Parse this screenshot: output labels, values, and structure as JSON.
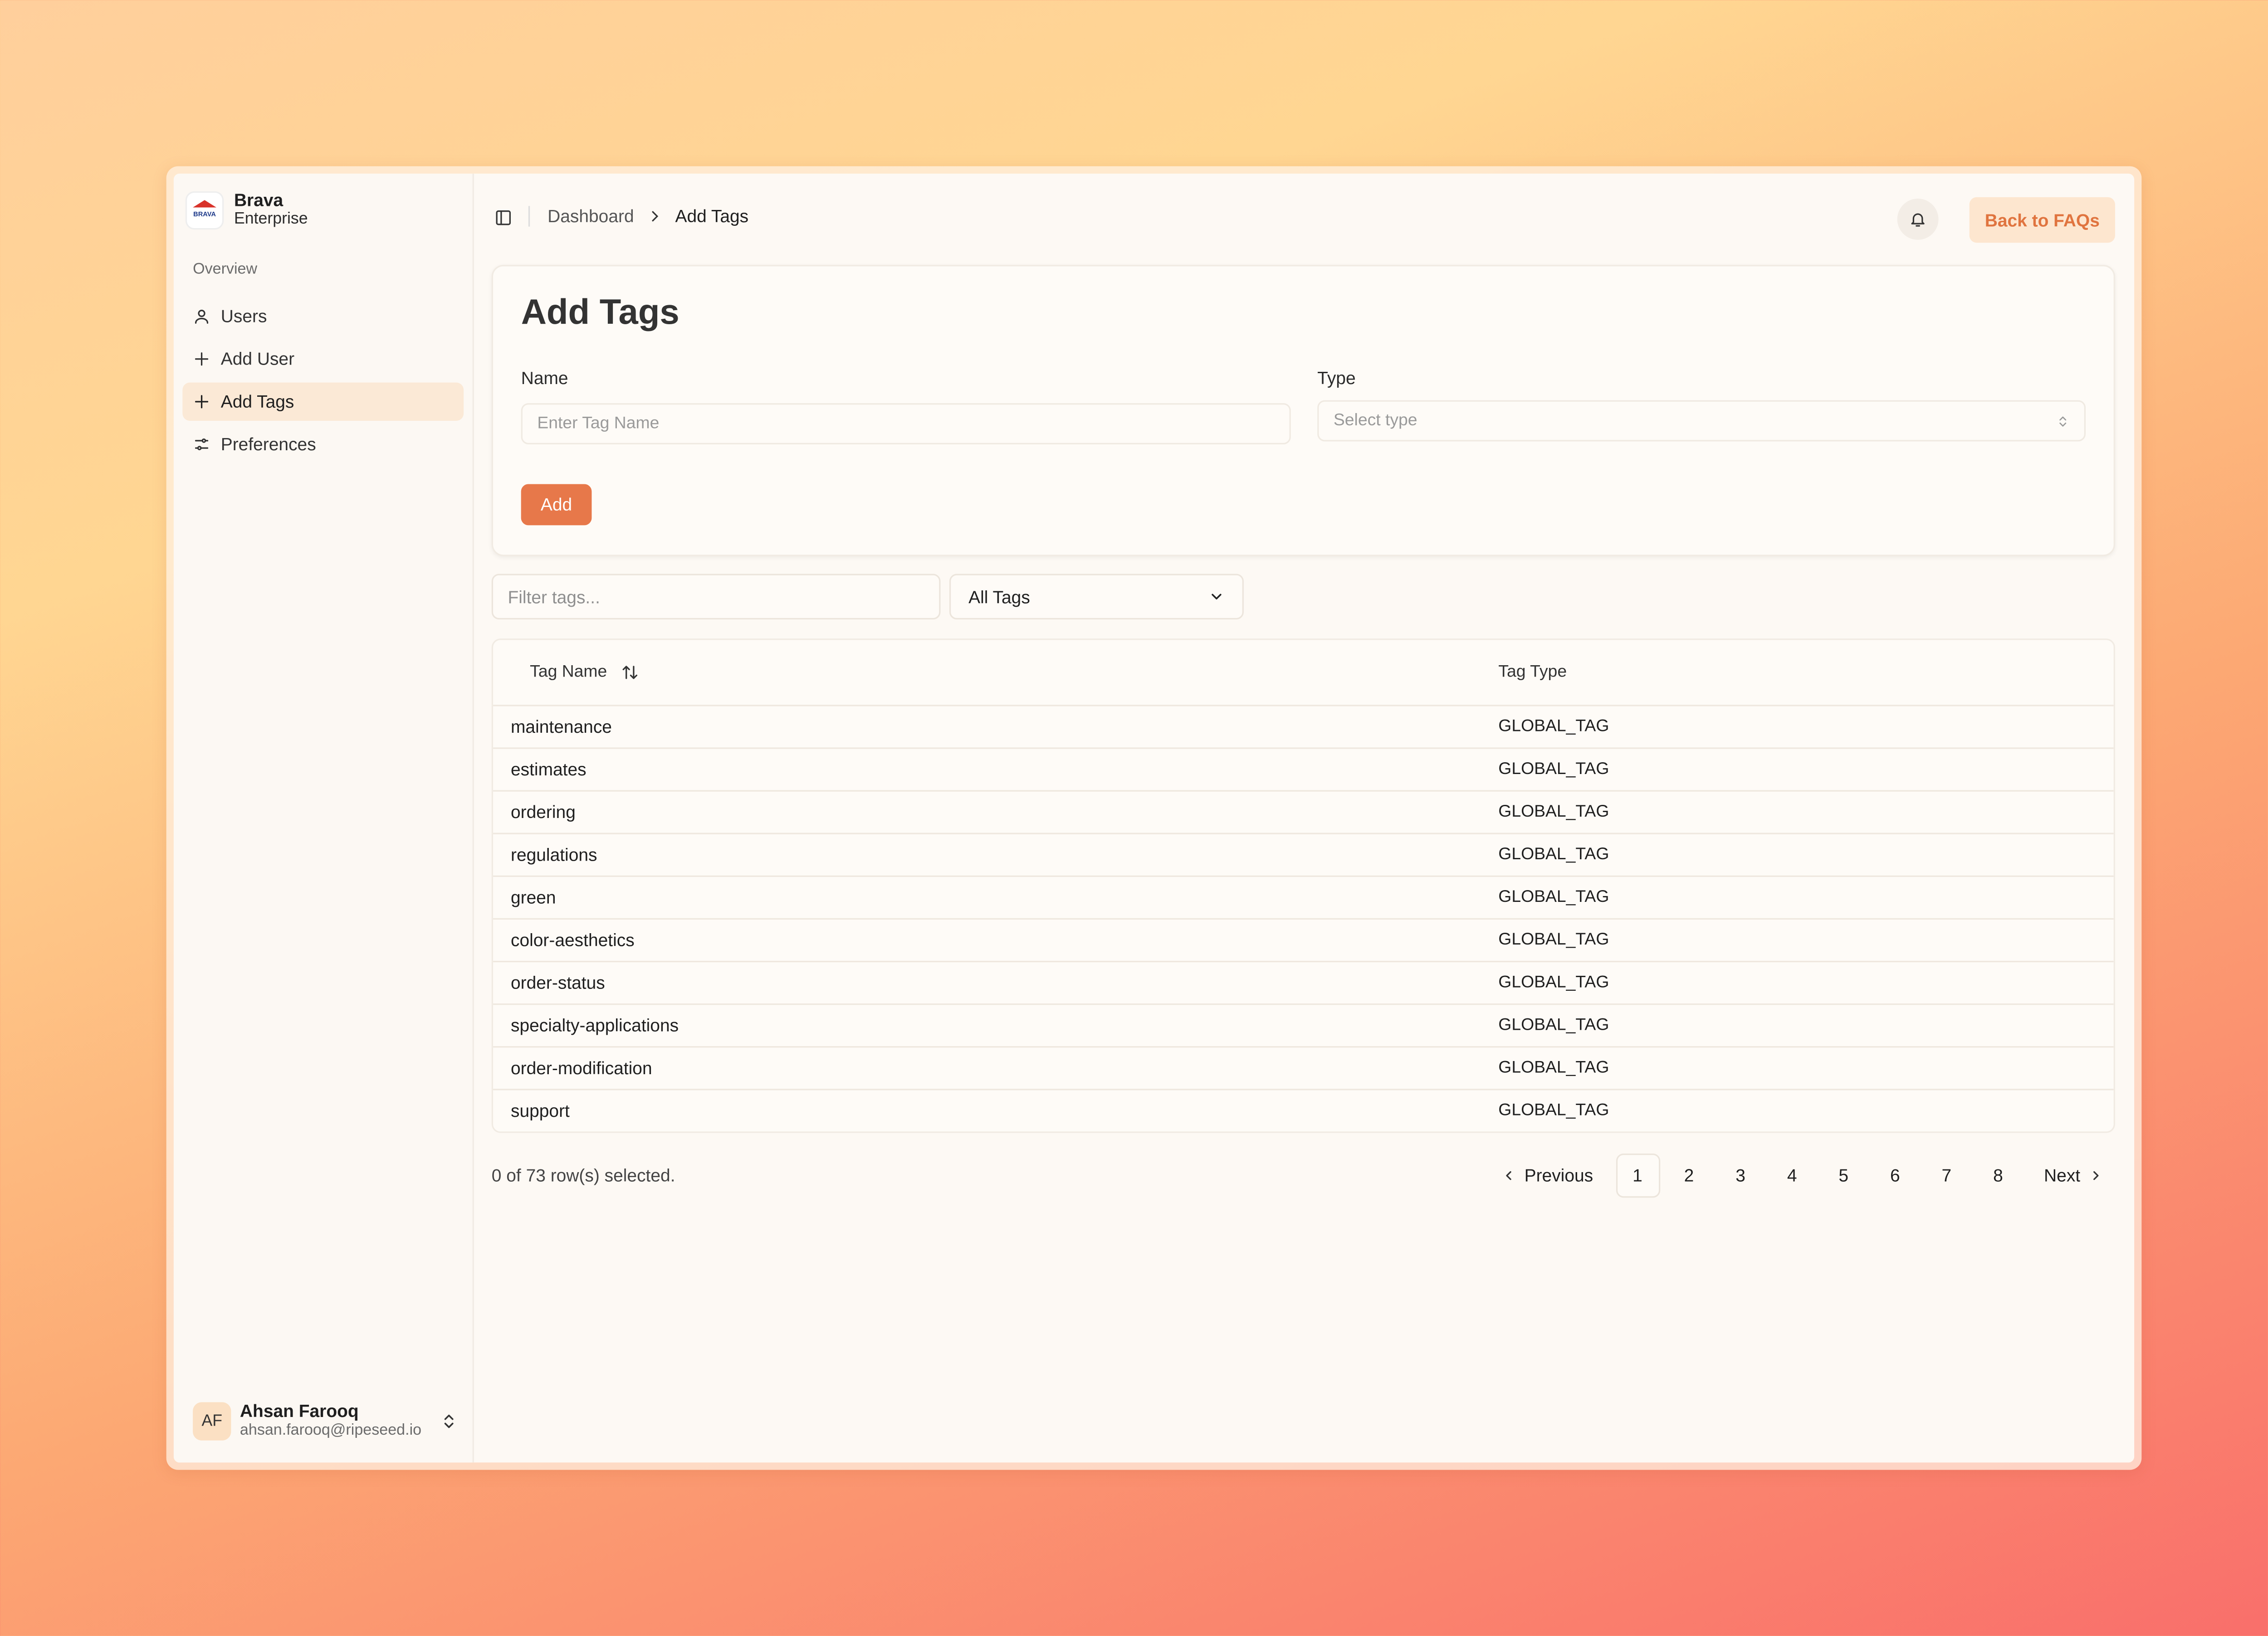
{
  "brand": {
    "logo_text": "BRAVA",
    "name": "Brava",
    "subtitle": "Enterprise"
  },
  "sidebar": {
    "section_label": "Overview",
    "items": [
      {
        "label": "Users",
        "icon": "user-icon"
      },
      {
        "label": "Add User",
        "icon": "plus-icon"
      },
      {
        "label": "Add Tags",
        "icon": "plus-icon",
        "active": true
      },
      {
        "label": "Preferences",
        "icon": "sliders-icon"
      }
    ]
  },
  "user": {
    "initials": "AF",
    "name": "Ahsan Farooq",
    "email": "ahsan.farooq@ripeseed.io"
  },
  "header": {
    "breadcrumb": {
      "parent": "Dashboard",
      "current": "Add Tags"
    },
    "back_label": "Back to FAQs"
  },
  "form": {
    "title": "Add Tags",
    "name_label": "Name",
    "name_placeholder": "Enter Tag Name",
    "type_label": "Type",
    "type_placeholder": "Select type",
    "add_label": "Add"
  },
  "filters": {
    "search_placeholder": "Filter tags...",
    "type_selected": "All Tags"
  },
  "table": {
    "columns": [
      "Tag Name",
      "Tag Type"
    ],
    "rows": [
      {
        "name": "maintenance",
        "type": "GLOBAL_TAG"
      },
      {
        "name": "estimates",
        "type": "GLOBAL_TAG"
      },
      {
        "name": "ordering",
        "type": "GLOBAL_TAG"
      },
      {
        "name": "regulations",
        "type": "GLOBAL_TAG"
      },
      {
        "name": "green",
        "type": "GLOBAL_TAG"
      },
      {
        "name": "color-aesthetics",
        "type": "GLOBAL_TAG"
      },
      {
        "name": "order-status",
        "type": "GLOBAL_TAG"
      },
      {
        "name": "specialty-applications",
        "type": "GLOBAL_TAG"
      },
      {
        "name": "order-modification",
        "type": "GLOBAL_TAG"
      },
      {
        "name": "support",
        "type": "GLOBAL_TAG"
      }
    ]
  },
  "pagination": {
    "selected_text": "0 of 73 row(s) selected.",
    "previous_label": "Previous",
    "next_label": "Next",
    "pages": [
      "1",
      "2",
      "3",
      "4",
      "5",
      "6",
      "7",
      "8"
    ],
    "current_page": "1"
  },
  "colors": {
    "accent": "#e7784a",
    "accent_soft": "#fde6cf",
    "active_nav": "#fbe9d6"
  }
}
